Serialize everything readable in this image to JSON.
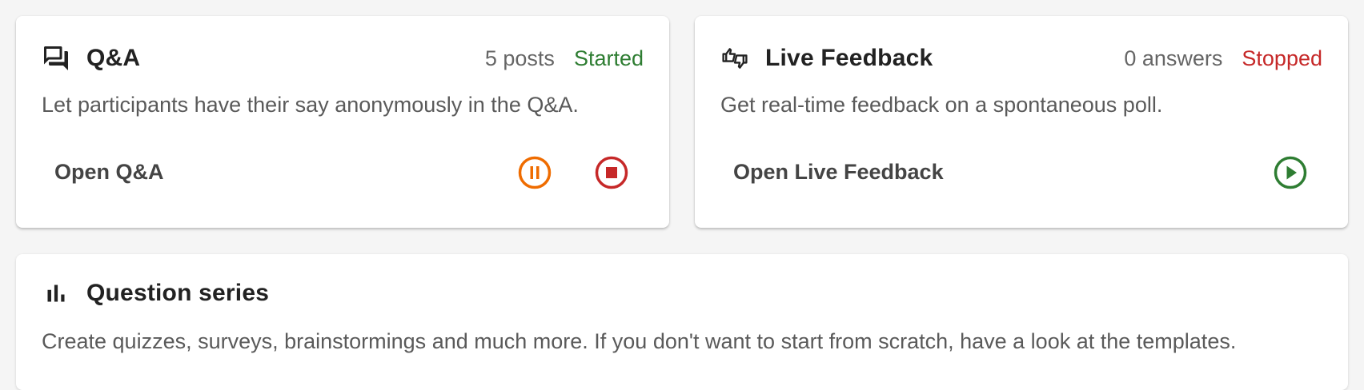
{
  "qa": {
    "title": "Q&A",
    "count": "5 posts",
    "status": "Started",
    "description": "Let participants have their say anonymously in the Q&A.",
    "open_label": "Open Q&A",
    "icon": "forum-icon"
  },
  "feedback": {
    "title": "Live Feedback",
    "count": "0 answers",
    "status": "Stopped",
    "description": "Get real-time feedback on a spontaneous poll.",
    "open_label": "Open Live Feedback",
    "icon": "thumbs-up-down-icon"
  },
  "series": {
    "title": "Question series",
    "description": "Create quizzes, surveys, brainstormings and much more. If you don't want to start from scratch, have a look at the templates.",
    "icon": "bar-chart-icon"
  },
  "colors": {
    "started": "#2e7d32",
    "stopped": "#c62828",
    "pause": "#ef6c00"
  }
}
